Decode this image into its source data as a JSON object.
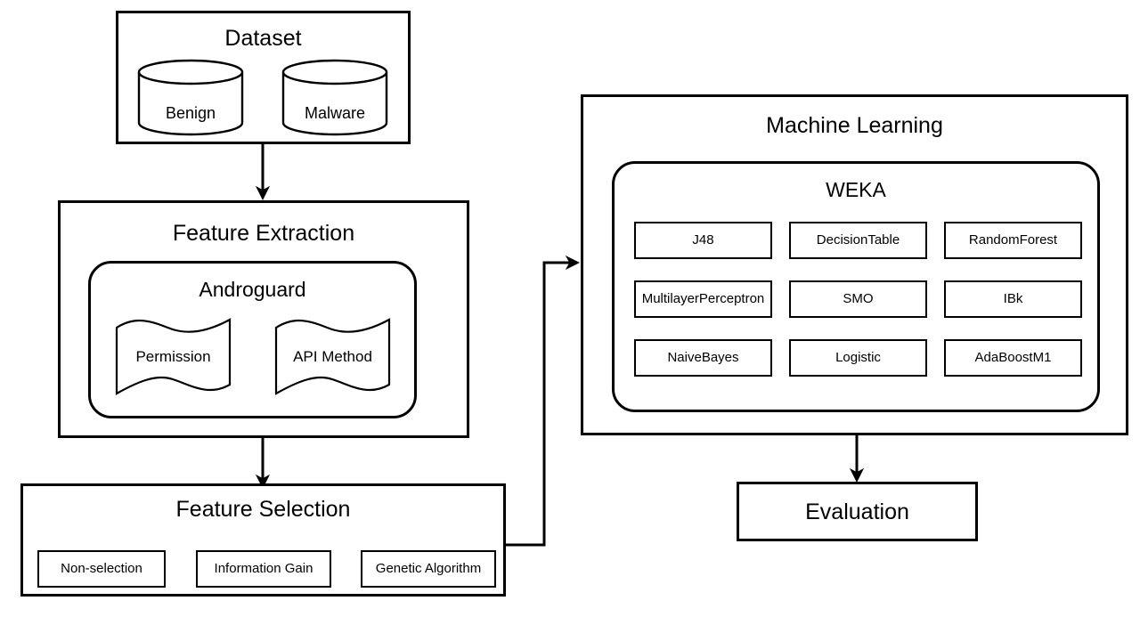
{
  "diagram": {
    "title_hidden": "Android malware detection pipeline flowchart",
    "stages": {
      "dataset": {
        "label": "Dataset",
        "stores": [
          {
            "label": "Benign",
            "icon": "database-cylinder-icon"
          },
          {
            "label": "Malware",
            "icon": "database-cylinder-icon"
          }
        ]
      },
      "feature_extraction": {
        "label": "Feature Extraction",
        "tool": {
          "label": "Androguard",
          "artifacts": [
            {
              "label": "Permission",
              "icon": "document-wave-icon"
            },
            {
              "label": "API Method",
              "icon": "document-wave-icon"
            }
          ]
        }
      },
      "feature_selection": {
        "label": "Feature Selection",
        "methods": [
          {
            "label": "Non-selection"
          },
          {
            "label": "Information Gain"
          },
          {
            "label": "Genetic Algorithm"
          }
        ]
      },
      "machine_learning": {
        "label": "Machine Learning",
        "tool": {
          "label": "WEKA",
          "algorithms": [
            {
              "label": "J48"
            },
            {
              "label": "DecisionTable"
            },
            {
              "label": "RandomForest"
            },
            {
              "label": "MultilayerPerceptron"
            },
            {
              "label": "SMO"
            },
            {
              "label": "IBk"
            },
            {
              "label": "NaiveBayes"
            },
            {
              "label": "Logistic"
            },
            {
              "label": "AdaBoostM1"
            }
          ]
        }
      },
      "evaluation": {
        "label": "Evaluation"
      }
    },
    "connectors": [
      {
        "name": "dataset-to-feature-extraction",
        "kind": "arrow-down"
      },
      {
        "name": "feature-extraction-to-feature-selection",
        "kind": "arrow-down"
      },
      {
        "name": "feature-selection-to-machine-learning",
        "kind": "elbow-arrow-right"
      },
      {
        "name": "machine-learning-to-evaluation",
        "kind": "arrow-down"
      }
    ],
    "colors": {
      "stroke": "#000000",
      "background": "#ffffff",
      "text": "#000000"
    }
  }
}
